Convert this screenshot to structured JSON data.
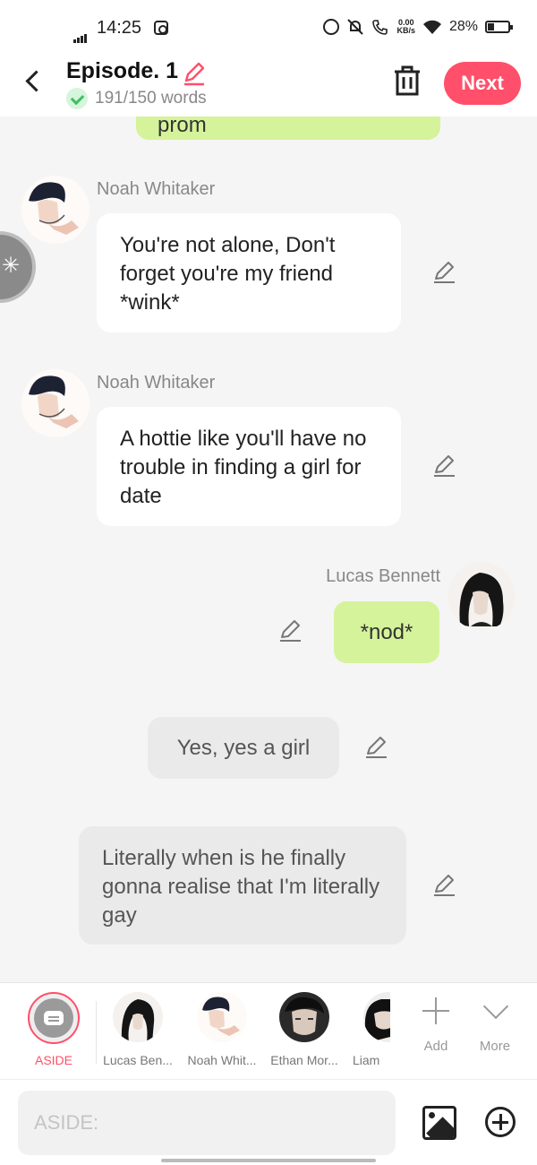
{
  "status_bar": {
    "time": "14:25",
    "net_speed_value": "0.00",
    "net_speed_unit": "KB/s",
    "battery": "28%"
  },
  "header": {
    "title": "Episode. 1",
    "word_count": "191/150 words",
    "next_label": "Next",
    "accent_color": "#ff4f6a"
  },
  "chat": {
    "top_partial_text": "prom",
    "messages": [
      {
        "sender": "Noah Whitaker",
        "text": "You're not alone, Don't forget you're my friend *wink*",
        "side": "left"
      },
      {
        "sender": "Noah Whitaker",
        "text": "A hottie like you'll have no trouble in finding a girl for date",
        "side": "left"
      },
      {
        "sender": "Lucas Bennett",
        "text": "*nod*",
        "side": "right"
      },
      {
        "sender": "",
        "text": "Yes, yes a girl",
        "side": "aside"
      },
      {
        "sender": "",
        "text": "Literally when is he finally gonna realise that I'm literally gay",
        "side": "aside"
      }
    ]
  },
  "character_bar": {
    "aside_label": "ASIDE",
    "characters": [
      {
        "name": "Lucas Ben..."
      },
      {
        "name": "Noah Whit..."
      },
      {
        "name": "Ethan Mor..."
      },
      {
        "name": "Liam"
      }
    ],
    "add_label": "Add",
    "more_label": "More"
  },
  "input_bar": {
    "placeholder": "ASIDE:"
  },
  "icons": [
    "signal-icon",
    "instagram-icon",
    "alarm-icon",
    "mute-icon",
    "wifi-call-icon",
    "wifi-icon",
    "battery-icon",
    "back-icon",
    "pencil-icon",
    "check-icon",
    "trash-icon",
    "image-icon",
    "plus-circle-icon"
  ]
}
